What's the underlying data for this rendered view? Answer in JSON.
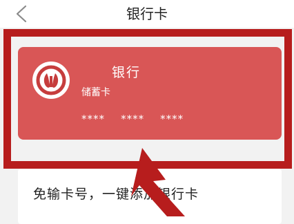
{
  "header": {
    "back_icon": "chevron-left-icon",
    "title": "银行卡"
  },
  "card": {
    "logo_icon": "bank-logo-icon",
    "bank_name": "银行",
    "card_type": "储蓄卡",
    "number_groups": [
      "****",
      "****",
      "****"
    ],
    "color": "#d95656"
  },
  "add_card": {
    "label": "免输卡号，一键添加银行卡"
  },
  "annotation": {
    "highlight_color": "#b71d1d",
    "arrow_icon": "pointer-arrow-icon"
  }
}
